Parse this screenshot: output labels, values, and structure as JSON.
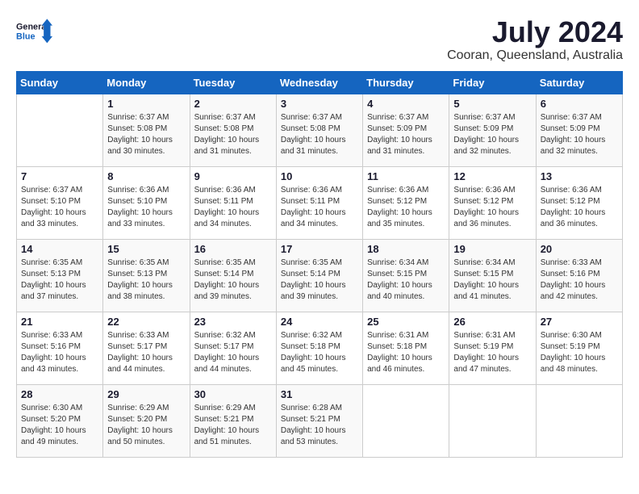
{
  "header": {
    "logo_general": "General",
    "logo_blue": "Blue",
    "month_year": "July 2024",
    "location": "Cooran, Queensland, Australia"
  },
  "calendar": {
    "days_of_week": [
      "Sunday",
      "Monday",
      "Tuesday",
      "Wednesday",
      "Thursday",
      "Friday",
      "Saturday"
    ],
    "weeks": [
      [
        {
          "day": "",
          "info": ""
        },
        {
          "day": "1",
          "info": "Sunrise: 6:37 AM\nSunset: 5:08 PM\nDaylight: 10 hours\nand 30 minutes."
        },
        {
          "day": "2",
          "info": "Sunrise: 6:37 AM\nSunset: 5:08 PM\nDaylight: 10 hours\nand 31 minutes."
        },
        {
          "day": "3",
          "info": "Sunrise: 6:37 AM\nSunset: 5:08 PM\nDaylight: 10 hours\nand 31 minutes."
        },
        {
          "day": "4",
          "info": "Sunrise: 6:37 AM\nSunset: 5:09 PM\nDaylight: 10 hours\nand 31 minutes."
        },
        {
          "day": "5",
          "info": "Sunrise: 6:37 AM\nSunset: 5:09 PM\nDaylight: 10 hours\nand 32 minutes."
        },
        {
          "day": "6",
          "info": "Sunrise: 6:37 AM\nSunset: 5:09 PM\nDaylight: 10 hours\nand 32 minutes."
        }
      ],
      [
        {
          "day": "7",
          "info": "Sunrise: 6:37 AM\nSunset: 5:10 PM\nDaylight: 10 hours\nand 33 minutes."
        },
        {
          "day": "8",
          "info": "Sunrise: 6:36 AM\nSunset: 5:10 PM\nDaylight: 10 hours\nand 33 minutes."
        },
        {
          "day": "9",
          "info": "Sunrise: 6:36 AM\nSunset: 5:11 PM\nDaylight: 10 hours\nand 34 minutes."
        },
        {
          "day": "10",
          "info": "Sunrise: 6:36 AM\nSunset: 5:11 PM\nDaylight: 10 hours\nand 34 minutes."
        },
        {
          "day": "11",
          "info": "Sunrise: 6:36 AM\nSunset: 5:12 PM\nDaylight: 10 hours\nand 35 minutes."
        },
        {
          "day": "12",
          "info": "Sunrise: 6:36 AM\nSunset: 5:12 PM\nDaylight: 10 hours\nand 36 minutes."
        },
        {
          "day": "13",
          "info": "Sunrise: 6:36 AM\nSunset: 5:12 PM\nDaylight: 10 hours\nand 36 minutes."
        }
      ],
      [
        {
          "day": "14",
          "info": "Sunrise: 6:35 AM\nSunset: 5:13 PM\nDaylight: 10 hours\nand 37 minutes."
        },
        {
          "day": "15",
          "info": "Sunrise: 6:35 AM\nSunset: 5:13 PM\nDaylight: 10 hours\nand 38 minutes."
        },
        {
          "day": "16",
          "info": "Sunrise: 6:35 AM\nSunset: 5:14 PM\nDaylight: 10 hours\nand 39 minutes."
        },
        {
          "day": "17",
          "info": "Sunrise: 6:35 AM\nSunset: 5:14 PM\nDaylight: 10 hours\nand 39 minutes."
        },
        {
          "day": "18",
          "info": "Sunrise: 6:34 AM\nSunset: 5:15 PM\nDaylight: 10 hours\nand 40 minutes."
        },
        {
          "day": "19",
          "info": "Sunrise: 6:34 AM\nSunset: 5:15 PM\nDaylight: 10 hours\nand 41 minutes."
        },
        {
          "day": "20",
          "info": "Sunrise: 6:33 AM\nSunset: 5:16 PM\nDaylight: 10 hours\nand 42 minutes."
        }
      ],
      [
        {
          "day": "21",
          "info": "Sunrise: 6:33 AM\nSunset: 5:16 PM\nDaylight: 10 hours\nand 43 minutes."
        },
        {
          "day": "22",
          "info": "Sunrise: 6:33 AM\nSunset: 5:17 PM\nDaylight: 10 hours\nand 44 minutes."
        },
        {
          "day": "23",
          "info": "Sunrise: 6:32 AM\nSunset: 5:17 PM\nDaylight: 10 hours\nand 44 minutes."
        },
        {
          "day": "24",
          "info": "Sunrise: 6:32 AM\nSunset: 5:18 PM\nDaylight: 10 hours\nand 45 minutes."
        },
        {
          "day": "25",
          "info": "Sunrise: 6:31 AM\nSunset: 5:18 PM\nDaylight: 10 hours\nand 46 minutes."
        },
        {
          "day": "26",
          "info": "Sunrise: 6:31 AM\nSunset: 5:19 PM\nDaylight: 10 hours\nand 47 minutes."
        },
        {
          "day": "27",
          "info": "Sunrise: 6:30 AM\nSunset: 5:19 PM\nDaylight: 10 hours\nand 48 minutes."
        }
      ],
      [
        {
          "day": "28",
          "info": "Sunrise: 6:30 AM\nSunset: 5:20 PM\nDaylight: 10 hours\nand 49 minutes."
        },
        {
          "day": "29",
          "info": "Sunrise: 6:29 AM\nSunset: 5:20 PM\nDaylight: 10 hours\nand 50 minutes."
        },
        {
          "day": "30",
          "info": "Sunrise: 6:29 AM\nSunset: 5:21 PM\nDaylight: 10 hours\nand 51 minutes."
        },
        {
          "day": "31",
          "info": "Sunrise: 6:28 AM\nSunset: 5:21 PM\nDaylight: 10 hours\nand 53 minutes."
        },
        {
          "day": "",
          "info": ""
        },
        {
          "day": "",
          "info": ""
        },
        {
          "day": "",
          "info": ""
        }
      ]
    ]
  }
}
